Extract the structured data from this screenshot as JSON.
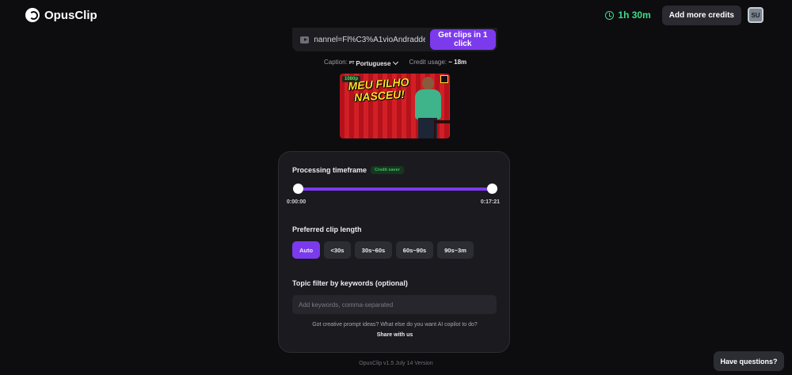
{
  "app": {
    "name": "OpusClip"
  },
  "header": {
    "credits_time": "1h 30m",
    "add_credits_label": "Add more credits",
    "avatar_initials": "SU"
  },
  "url_bar": {
    "url_value": "nannel=Fl%C3%A1vioAndradde",
    "submit_label": "Get clips in 1 click"
  },
  "caption": {
    "label": "Caption:",
    "flag": "PT",
    "language": "Portuguese",
    "credit_label": "Credit usage:",
    "credit_value": "~ 18m"
  },
  "thumbnail": {
    "resolution": "1080p",
    "title": "MEU FILHO NASCEU!"
  },
  "panel": {
    "timeframe_label": "Processing timeframe",
    "credit_saver": "Credit saver",
    "start_time": "0:00:00",
    "end_time": "0:17:21",
    "range_start_fraction": 0.0,
    "range_end_fraction": 1.0,
    "clip_length_label": "Preferred clip length",
    "clip_options": [
      "Auto",
      "<30s",
      "30s~60s",
      "60s~90s",
      "90s~3m"
    ],
    "selected_option": "Auto",
    "topic_label": "Topic filter by keywords (optional)",
    "topic_placeholder": "Add keywords, comma-separated",
    "prompt_text": "Got creative prompt ideas? What else do you want AI copilot to do?",
    "share_label": "Share with us"
  },
  "footer": {
    "version": "OpusClip v1.5 July 14 Version"
  },
  "help_button": "Have questions?",
  "colors": {
    "accent": "#7c3aed",
    "credit_green": "#3ddc84",
    "background": "#0d0d10",
    "panel": "#1a1a1f"
  }
}
